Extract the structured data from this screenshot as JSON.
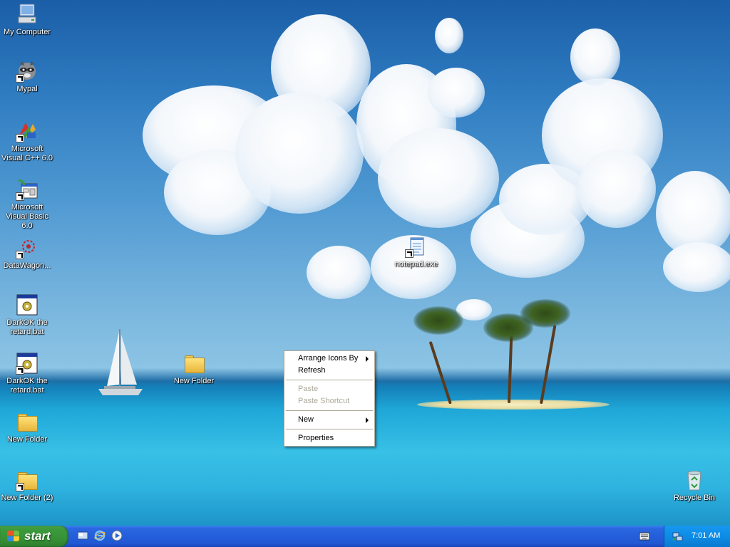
{
  "desktop": {
    "icons": [
      {
        "label": "My Computer"
      },
      {
        "label": "Mypal"
      },
      {
        "label": "Microsoft Visual C++ 6.0"
      },
      {
        "label": "Microsoft Visual Basic 6.0"
      },
      {
        "label": "DataWagon..."
      },
      {
        "label": "DarkOK the retard.bat"
      },
      {
        "label": "DarkOK the retard.bat"
      },
      {
        "label": "New Folder"
      },
      {
        "label": "New Folder (2)"
      },
      {
        "label": "New Folder"
      },
      {
        "label": "notepad.exe"
      },
      {
        "label": "Recycle Bin"
      }
    ]
  },
  "context_menu": {
    "arrange_icons_by": "Arrange Icons By",
    "refresh": "Refresh",
    "paste": "Paste",
    "paste_shortcut": "Paste Shortcut",
    "new": "New",
    "properties": "Properties"
  },
  "taskbar": {
    "start_label": "start",
    "clock": "7:01 AM"
  },
  "colors": {
    "taskbar_blue": "#245edb",
    "start_green": "#3c9a3c",
    "tray_blue": "#0d8ce6"
  }
}
